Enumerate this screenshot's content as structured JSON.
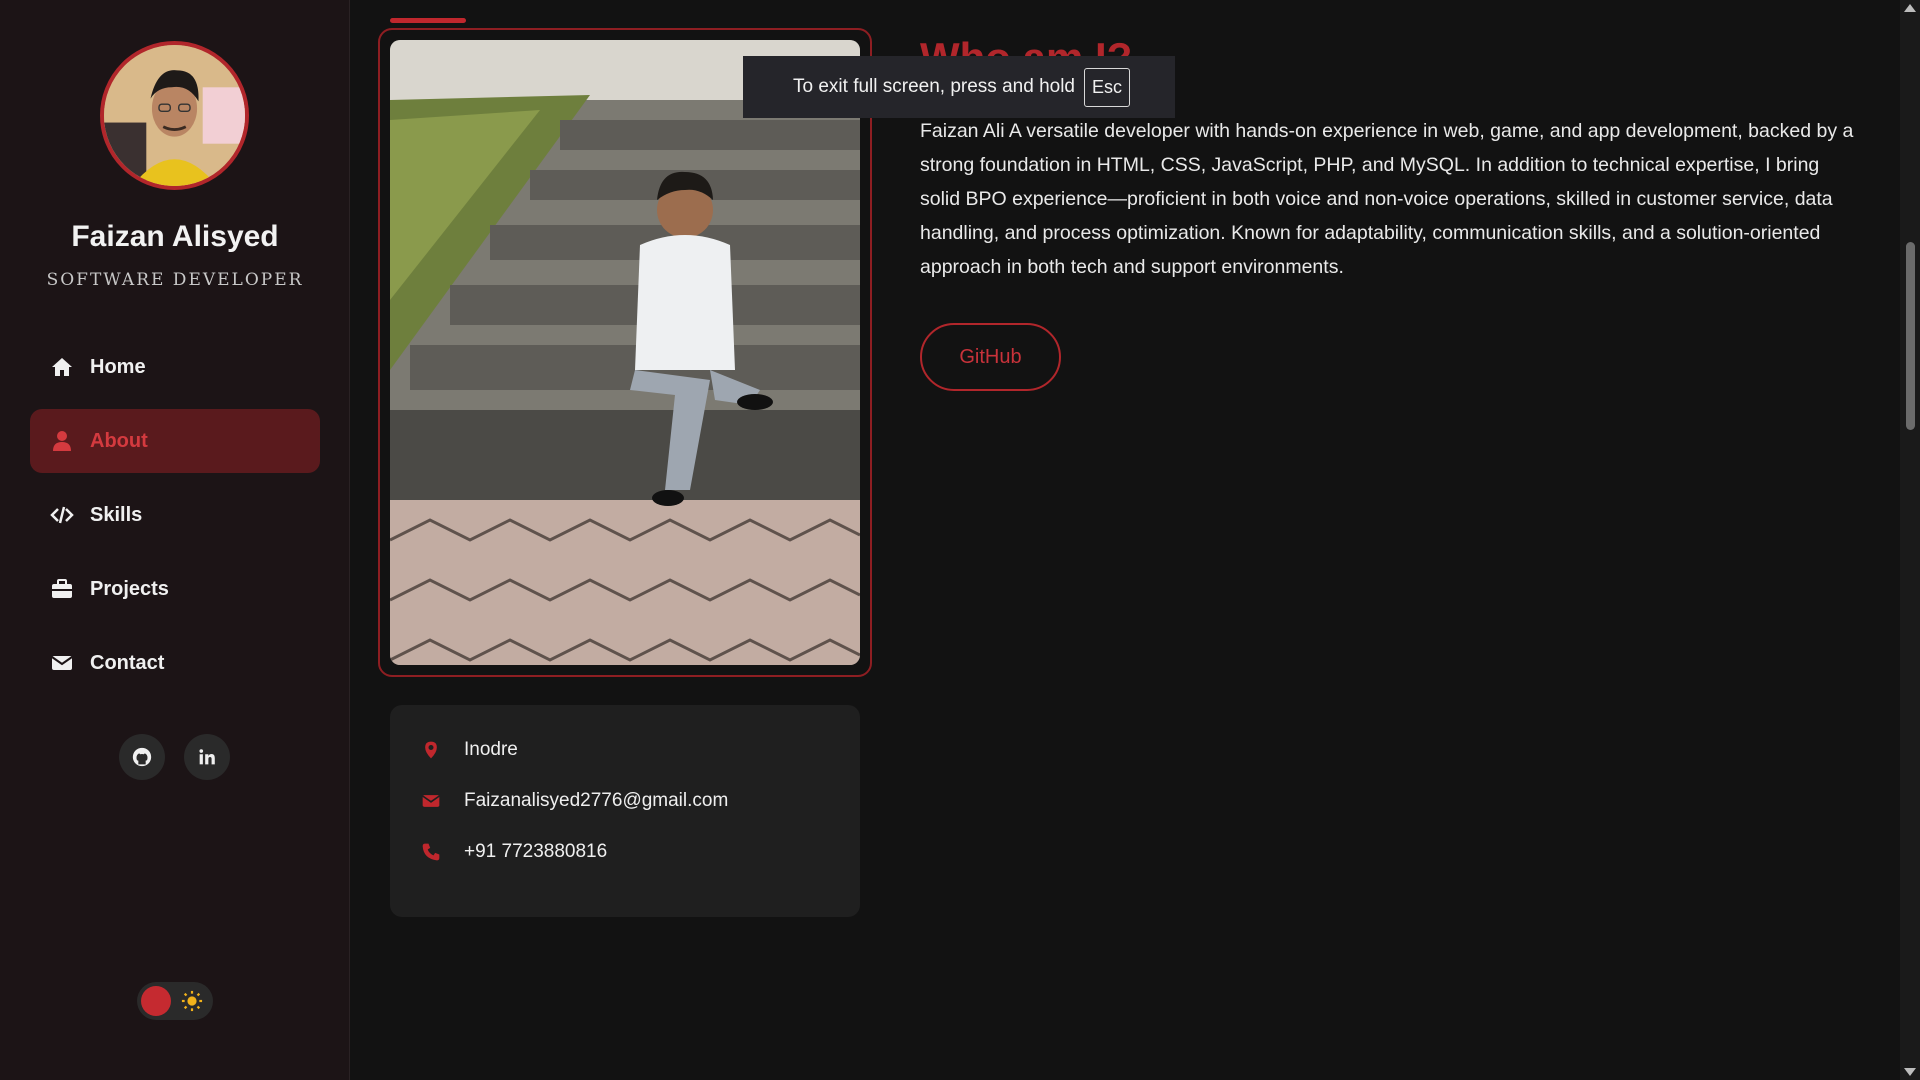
{
  "sidebar": {
    "profile": {
      "name": "Faizan Alisyed",
      "role": "SOFTWARE DEVELOPER"
    },
    "nav": [
      {
        "label": "Home",
        "icon": "home-icon"
      },
      {
        "label": "About",
        "icon": "user-icon",
        "active": true
      },
      {
        "label": "Skills",
        "icon": "code-icon"
      },
      {
        "label": "Projects",
        "icon": "briefcase-icon"
      },
      {
        "label": "Contact",
        "icon": "envelope-icon"
      }
    ],
    "social": [
      "github-icon",
      "linkedin-icon"
    ]
  },
  "main": {
    "section_title": "Who am I?",
    "about_text": "Faizan Ali A versatile developer with hands-on experience in web, game, and app development, backed by a strong foundation in HTML, CSS, JavaScript, PHP, and MySQL. In addition to technical expertise, I bring solid BPO experience—proficient in both voice and non-voice operations, skilled in customer service, data handling, and process optimization. Known for adaptability, communication skills, and a solution-oriented approach in both tech and support environments.",
    "github_button": "GitHub",
    "info": {
      "location": "Inodre",
      "email": "Faizanalisyed2776@gmail.com",
      "phone": "+91 7723880816"
    }
  },
  "fullscreen_notice": {
    "text": "To exit full screen, press and hold",
    "key": "Esc"
  },
  "colors": {
    "accent": "#b1262b",
    "sidebar_bg": "#1c1416",
    "page_bg": "#121212",
    "active_nav_bg": "#5a1a1d"
  }
}
